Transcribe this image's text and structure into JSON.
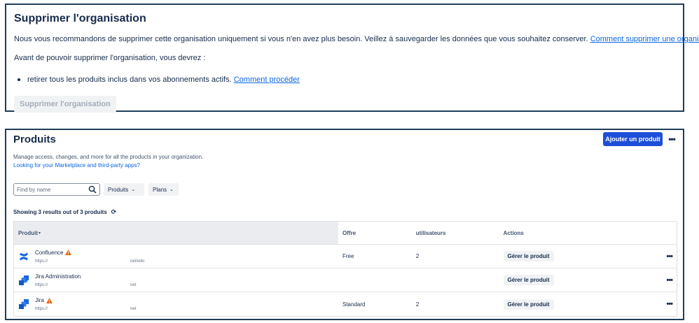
{
  "delete_section": {
    "title": "Supprimer l'organisation",
    "description": "Nous vous recommandons de supprimer cette organisation uniquement si vous n'en avez plus besoin. Veillez à sauvegarder les données que vous souhaitez conserver.",
    "description_link": "Comment supprimer une organisation",
    "requirement_intro": "Avant de pouvoir supprimer l'organisation, vous devrez :",
    "requirement_item": "retirer tous les produits inclus dans vos abonnements actifs.",
    "requirement_link": "Comment procéder",
    "button_label": "Supprimer l'organisation"
  },
  "products_section": {
    "title": "Produits",
    "add_button": "Ajouter un produit",
    "more_icon": "more-icon",
    "description": "Manage access, changes, and more for all the products in your organization.",
    "marketplace_link": "Looking for your Marketplace and third-party apps?",
    "search_placeholder": "Find by name",
    "filter_products": "Produits",
    "filter_plans": "Plans",
    "showing": "Showing 3 results out of 3 produits",
    "columns": {
      "product": "Produit",
      "offer": "Offre",
      "users": "utilisateurs",
      "actions": "Actions"
    },
    "rows": [
      {
        "name": "Confluence",
        "url_start": "https://",
        "url_end": "net/wiki",
        "offer": "Free",
        "users": "2",
        "action": "Gérer le produit",
        "warning": true,
        "logo": "confluence-logo"
      },
      {
        "name": "Jira Administration",
        "url_start": "https://",
        "url_end": "net",
        "offer": "",
        "users": "",
        "action": "Gérer le produit",
        "warning": false,
        "logo": "jira-logo"
      },
      {
        "name": "Jira",
        "url_start": "https://",
        "url_end": "net",
        "offer": "Standard",
        "users": "2",
        "action": "Gérer le produit",
        "warning": true,
        "logo": "jira-logo"
      }
    ]
  },
  "colors": {
    "primary": "#1d4ed8",
    "link": "#0c66e4",
    "warning": "#e56910",
    "border": "#1f3d5a"
  }
}
